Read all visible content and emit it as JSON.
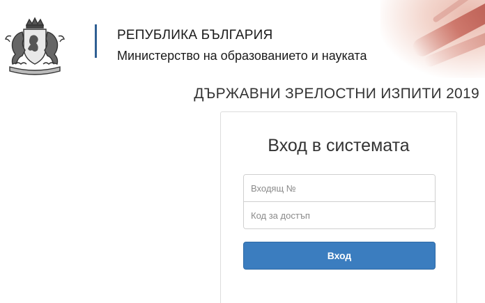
{
  "header": {
    "title": "РЕПУБЛИКА БЪЛГАРИЯ",
    "subtitle": "Министерство на образованието и науката",
    "logo_icon": "coat-of-arms-icon",
    "accent_color": "#2f5f93"
  },
  "exam": {
    "title": "ДЪРЖАВНИ ЗРЕЛОСТНИ ИЗПИТИ 2019"
  },
  "login": {
    "title": "Вход в системата",
    "incoming_number": {
      "value": "",
      "placeholder": "Входящ №"
    },
    "access_code": {
      "value": "",
      "placeholder": "Код за достъп"
    },
    "submit_label": "Вход",
    "button_color": "#3b7dbf"
  }
}
